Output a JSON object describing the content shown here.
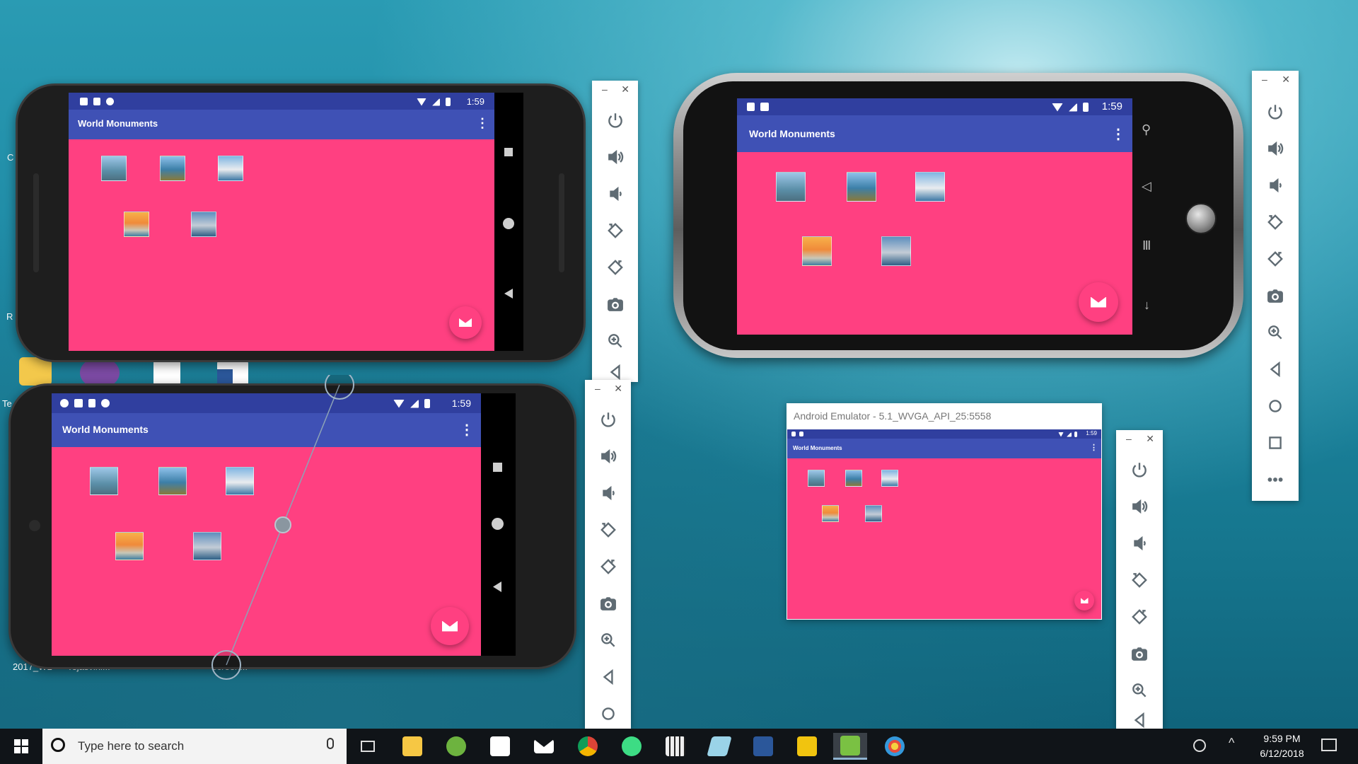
{
  "app": {
    "title": "World Monuments",
    "time": "1:59",
    "menu_glyph": "⋮",
    "fab_icon": "mail-icon",
    "thumbnails": [
      "statue-of-liberty",
      "eiffel-tower",
      "sydney-opera-house",
      "taj-mahal",
      "tower-bridge"
    ],
    "colors": {
      "accent": "#ff4081",
      "primary": "#3f51b5",
      "primary_dark": "#303f9f"
    }
  },
  "emulator_window": {
    "title": "Android Emulator - 5.1_WVGA_API_25:5558"
  },
  "toolbar": {
    "minimize": "–",
    "close": "✕",
    "buttons": [
      "power-icon",
      "volume-up-icon",
      "volume-down-icon",
      "rotate-left-icon",
      "rotate-right-icon",
      "camera-icon",
      "zoom-icon",
      "back-icon",
      "home-icon",
      "overview-icon",
      "more-icon"
    ]
  },
  "desktop": {
    "labels": [
      "C",
      "R",
      "Te",
      "2017_WL",
      "Tejasvini...",
      "Screen..."
    ]
  },
  "taskbar": {
    "search_placeholder": "Type here to search",
    "clock_time": "9:59 PM",
    "clock_date": "6/12/2018",
    "apps": [
      "task-view-icon",
      "file-explorer-icon",
      "spring-tool-icon",
      "sticky-notes-icon",
      "mail-icon",
      "chrome-icon",
      "android-studio-icon",
      "calculator-icon",
      "paint-3d-icon",
      "word-icon",
      "android-device-monitor-icon",
      "emulator-icon",
      "paint-icon"
    ]
  }
}
